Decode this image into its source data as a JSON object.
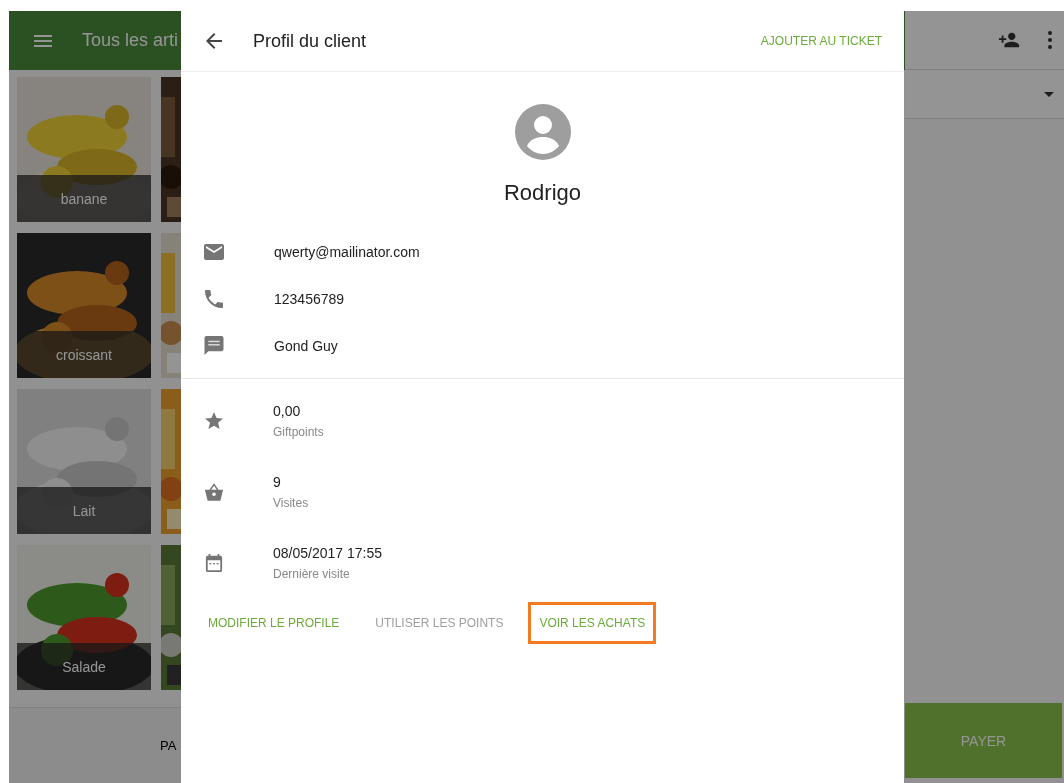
{
  "app": {
    "title": "Tous les arti",
    "products": [
      {
        "label": "banane"
      },
      {
        "label": "croissant"
      },
      {
        "label": "Lait"
      },
      {
        "label": "Salade"
      }
    ],
    "bottom_label": "PA",
    "pay_button": "PAYER"
  },
  "panel": {
    "title": "Profil du client",
    "action": "AJOUTER AU TICKET",
    "name": "Rodrigo",
    "contacts": [
      {
        "kind": "email",
        "value": "qwerty@mailinator.com"
      },
      {
        "kind": "phone",
        "value": "123456789"
      },
      {
        "kind": "note",
        "value": "Gond Guy"
      }
    ],
    "stats": [
      {
        "kind": "star",
        "value": "0,00",
        "label": "Giftpoints"
      },
      {
        "kind": "basket",
        "value": "9",
        "label": "Visites"
      },
      {
        "kind": "calendar",
        "value": "08/05/2017 17:55",
        "label": "Dernière visite"
      }
    ],
    "buttons": [
      {
        "label": "MODIFIER LE PROFILE",
        "disabled": false,
        "highlighted": false
      },
      {
        "label": "UTILISER LES POINTS",
        "disabled": true,
        "highlighted": false
      },
      {
        "label": "VOIR LES ACHATS",
        "disabled": false,
        "highlighted": true
      }
    ]
  }
}
